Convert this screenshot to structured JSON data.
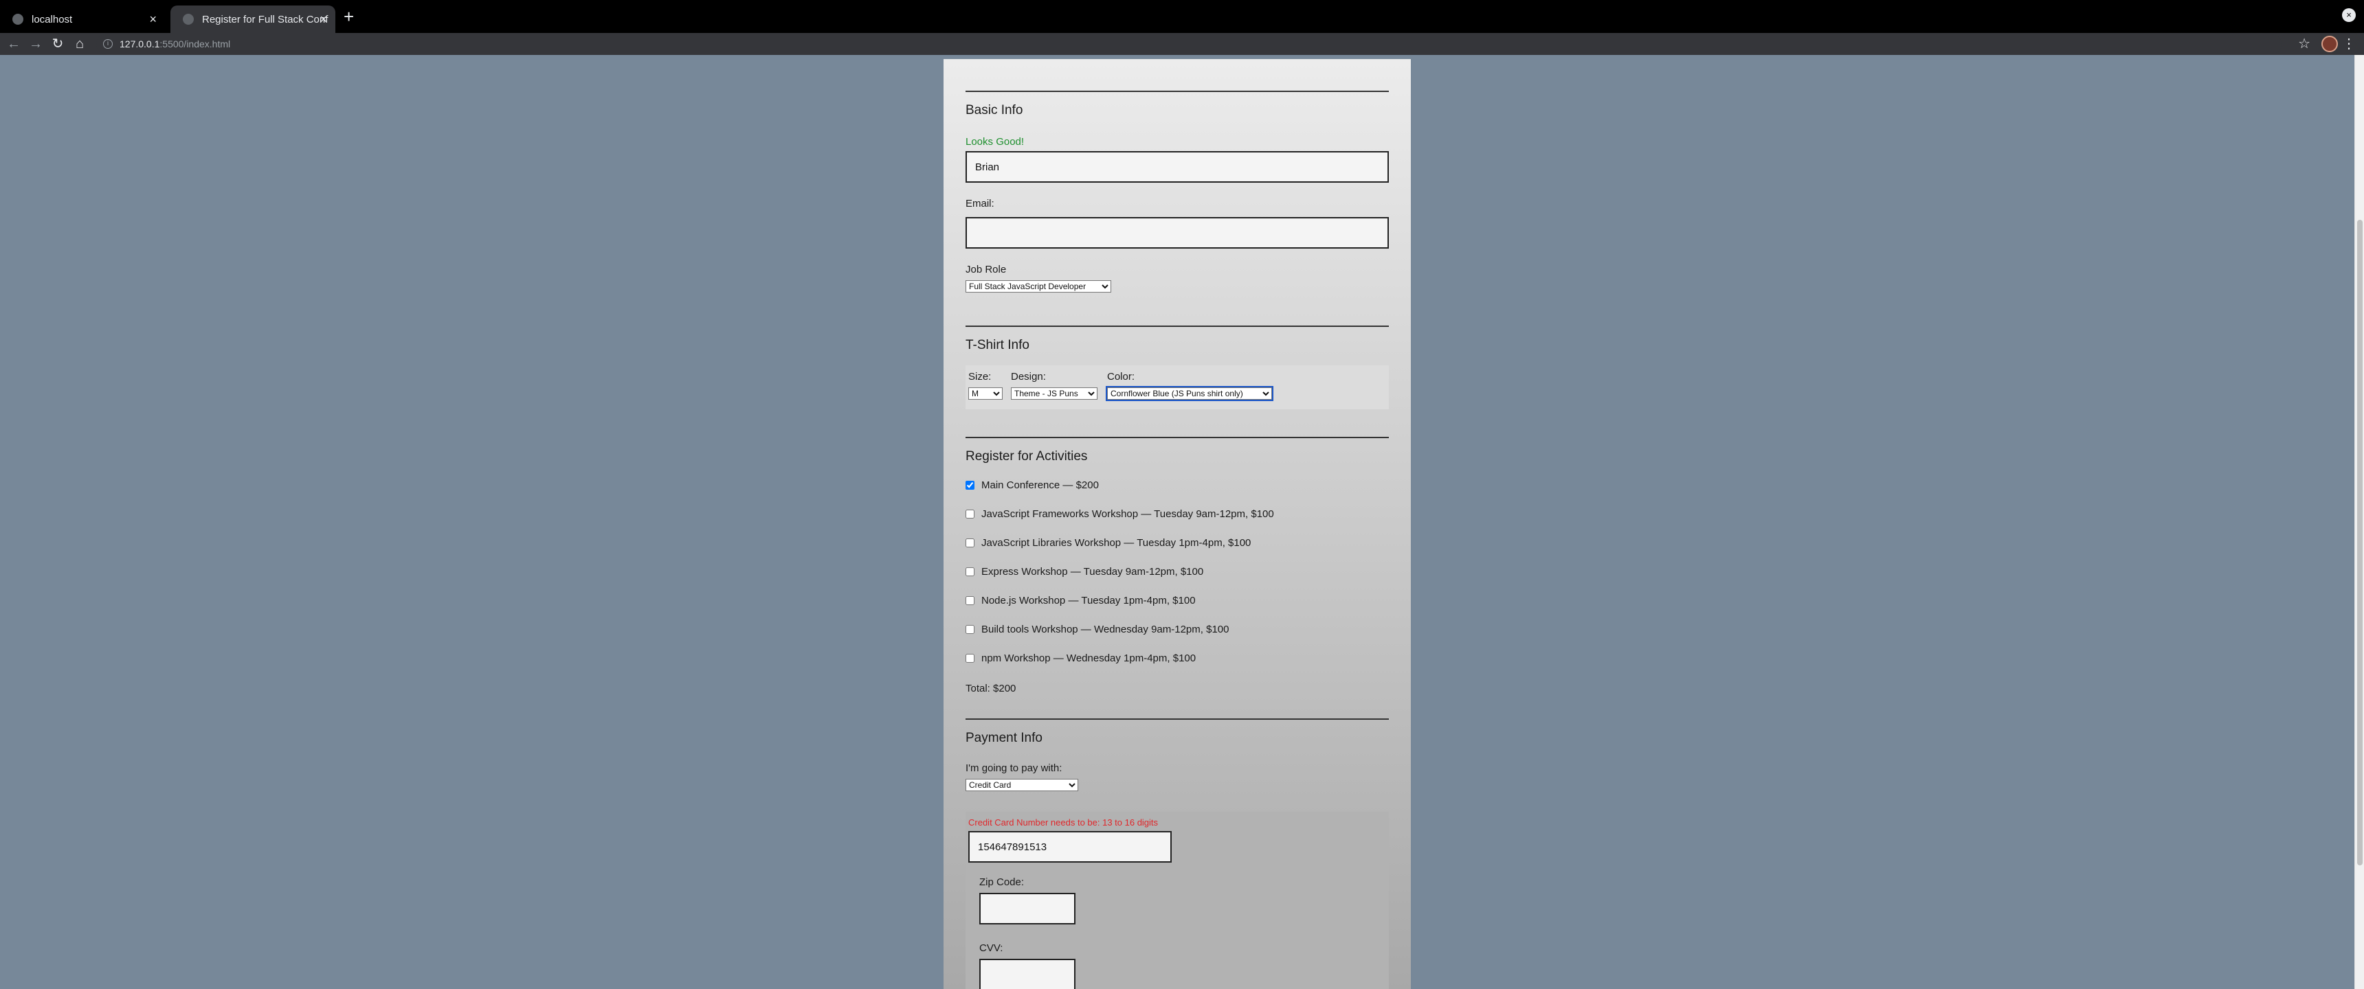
{
  "browser": {
    "tabs": [
      {
        "title": "localhost",
        "active": false
      },
      {
        "title": "Register for Full Stack Conf",
        "active": true
      }
    ],
    "url_host": "127.0.0.1",
    "url_rest": ":5500/index.html"
  },
  "form": {
    "basic_info": {
      "legend": "Basic Info",
      "name_valid_message": "Looks Good!",
      "name_value": "Brian",
      "email_label": "Email:",
      "email_value": "",
      "job_role_label": "Job Role",
      "job_role_selected": "Full Stack JavaScript Developer"
    },
    "tshirt": {
      "legend": "T-Shirt Info",
      "size_label": "Size:",
      "size_selected": "M",
      "design_label": "Design:",
      "design_selected": "Theme - JS Puns",
      "color_label": "Color:",
      "color_selected": "Cornflower Blue (JS Puns shirt only)"
    },
    "activities": {
      "legend": "Register for Activities",
      "items": [
        {
          "label": "Main Conference — $200",
          "checked": true
        },
        {
          "label": "JavaScript Frameworks Workshop — Tuesday 9am-12pm, $100",
          "checked": false
        },
        {
          "label": "JavaScript Libraries Workshop — Tuesday 1pm-4pm, $100",
          "checked": false
        },
        {
          "label": "Express Workshop — Tuesday 9am-12pm, $100",
          "checked": false
        },
        {
          "label": "Node.js Workshop — Tuesday 1pm-4pm, $100",
          "checked": false
        },
        {
          "label": "Build tools Workshop — Wednesday 9am-12pm, $100",
          "checked": false
        },
        {
          "label": "npm Workshop — Wednesday 1pm-4pm, $100",
          "checked": false
        }
      ],
      "total": "Total: $200"
    },
    "payment": {
      "legend": "Payment Info",
      "pay_label": "I'm going to pay with:",
      "pay_selected": "Credit Card",
      "cc_error": "Credit Card Number needs to be: 13 to 16 digits",
      "cc_value": "154647891513",
      "zip_label": "Zip Code:",
      "zip_value": "",
      "cvv_label": "CVV:",
      "cvv_value": ""
    }
  },
  "colors": {
    "brick": "#778899",
    "valid": "#1e8f2e",
    "error": "#e0272b"
  }
}
